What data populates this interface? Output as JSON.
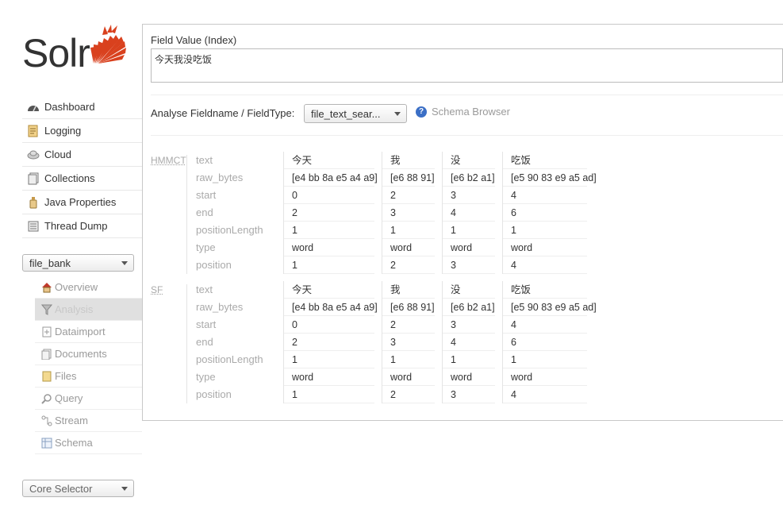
{
  "app": {
    "logo_text": "Solr",
    "logo_color": "#d9411e"
  },
  "nav": [
    {
      "label": "Dashboard",
      "icon": "dashboard-icon"
    },
    {
      "label": "Logging",
      "icon": "logging-icon"
    },
    {
      "label": "Cloud",
      "icon": "cloud-icon"
    },
    {
      "label": "Collections",
      "icon": "collections-icon"
    },
    {
      "label": "Java Properties",
      "icon": "java-icon"
    },
    {
      "label": "Thread Dump",
      "icon": "thread-dump-icon"
    }
  ],
  "core": {
    "selected": "file_bank",
    "menu": [
      {
        "label": "Overview",
        "icon": "overview-icon"
      },
      {
        "label": "Analysis",
        "icon": "analysis-icon",
        "active": true
      },
      {
        "label": "Dataimport",
        "icon": "dataimport-icon"
      },
      {
        "label": "Documents",
        "icon": "documents-icon"
      },
      {
        "label": "Files",
        "icon": "files-icon"
      },
      {
        "label": "Query",
        "icon": "query-icon"
      },
      {
        "label": "Stream",
        "icon": "stream-icon"
      },
      {
        "label": "Schema",
        "icon": "schema-icon"
      }
    ]
  },
  "core_selector": {
    "placeholder": "Core Selector"
  },
  "analysis": {
    "field_value_label": "Field Value (Index)",
    "field_value": "今天我没吃饭",
    "fieldtype_label": "Analyse Fieldname / FieldType:",
    "fieldtype_value": "file_text_sear...",
    "schema_browser_label": "Schema Browser",
    "row_labels": [
      "text",
      "raw_bytes",
      "start",
      "end",
      "positionLength",
      "type",
      "position"
    ],
    "groups": [
      {
        "name": "HMMCT",
        "tokens": [
          {
            "text": "今天",
            "raw_bytes": "[e4 bb 8a e5 a4 a9]",
            "start": "0",
            "end": "2",
            "positionLength": "1",
            "type": "word",
            "position": "1"
          },
          {
            "text": "我",
            "raw_bytes": "[e6 88 91]",
            "start": "2",
            "end": "3",
            "positionLength": "1",
            "type": "word",
            "position": "2"
          },
          {
            "text": "没",
            "raw_bytes": "[e6 b2 a1]",
            "start": "3",
            "end": "4",
            "positionLength": "1",
            "type": "word",
            "position": "3"
          },
          {
            "text": "吃饭",
            "raw_bytes": "[e5 90 83 e9 a5 ad]",
            "start": "4",
            "end": "6",
            "positionLength": "1",
            "type": "word",
            "position": "4"
          }
        ]
      },
      {
        "name": "SF",
        "tokens": [
          {
            "text": "今天",
            "raw_bytes": "[e4 bb 8a e5 a4 a9]",
            "start": "0",
            "end": "2",
            "positionLength": "1",
            "type": "word",
            "position": "1"
          },
          {
            "text": "我",
            "raw_bytes": "[e6 88 91]",
            "start": "2",
            "end": "3",
            "positionLength": "1",
            "type": "word",
            "position": "2"
          },
          {
            "text": "没",
            "raw_bytes": "[e6 b2 a1]",
            "start": "3",
            "end": "4",
            "positionLength": "1",
            "type": "word",
            "position": "3"
          },
          {
            "text": "吃饭",
            "raw_bytes": "[e5 90 83 e9 a5 ad]",
            "start": "4",
            "end": "6",
            "positionLength": "1",
            "type": "word",
            "position": "4"
          }
        ]
      }
    ]
  }
}
